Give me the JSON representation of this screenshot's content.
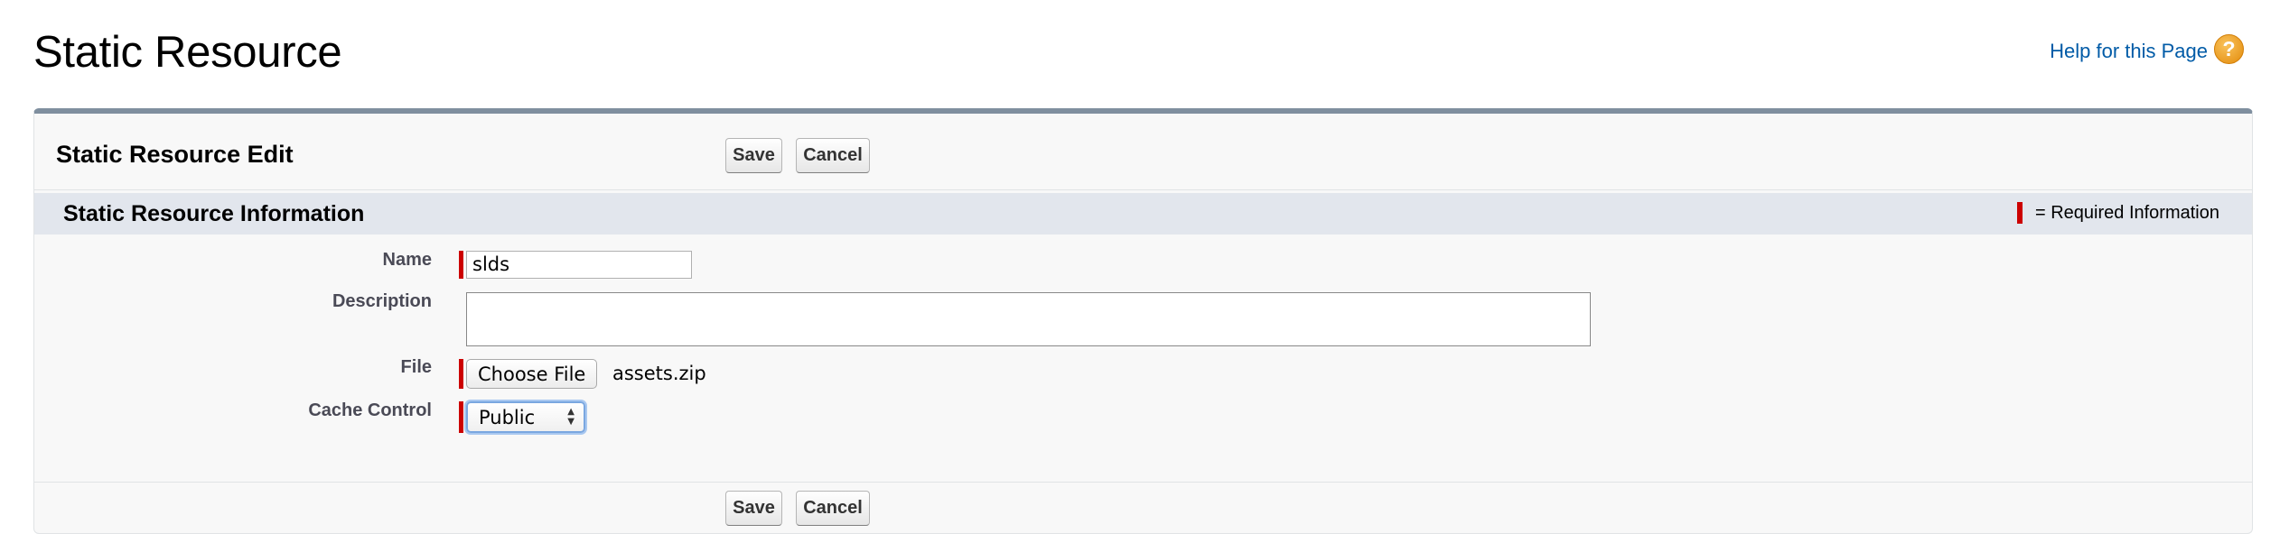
{
  "page": {
    "title": "Static Resource",
    "help_link": "Help for this Page",
    "help_icon": "?"
  },
  "edit_block": {
    "title": "Static Resource Edit",
    "save_label": "Save",
    "cancel_label": "Cancel"
  },
  "section": {
    "title": "Static Resource Information",
    "required_legend": "= Required Information"
  },
  "fields": {
    "name": {
      "label": "Name",
      "value": "slds"
    },
    "description": {
      "label": "Description",
      "value": ""
    },
    "file": {
      "label": "File",
      "button_label": "Choose File",
      "file_name": "assets.zip"
    },
    "cache_control": {
      "label": "Cache Control",
      "selected": "Public"
    }
  },
  "footer": {
    "save_label": "Save",
    "cancel_label": "Cancel"
  },
  "colors": {
    "required": "#cc0000",
    "link": "#015ba7",
    "section_bg": "#e2e6ed",
    "panel_top_border": "#7f8f9f"
  }
}
